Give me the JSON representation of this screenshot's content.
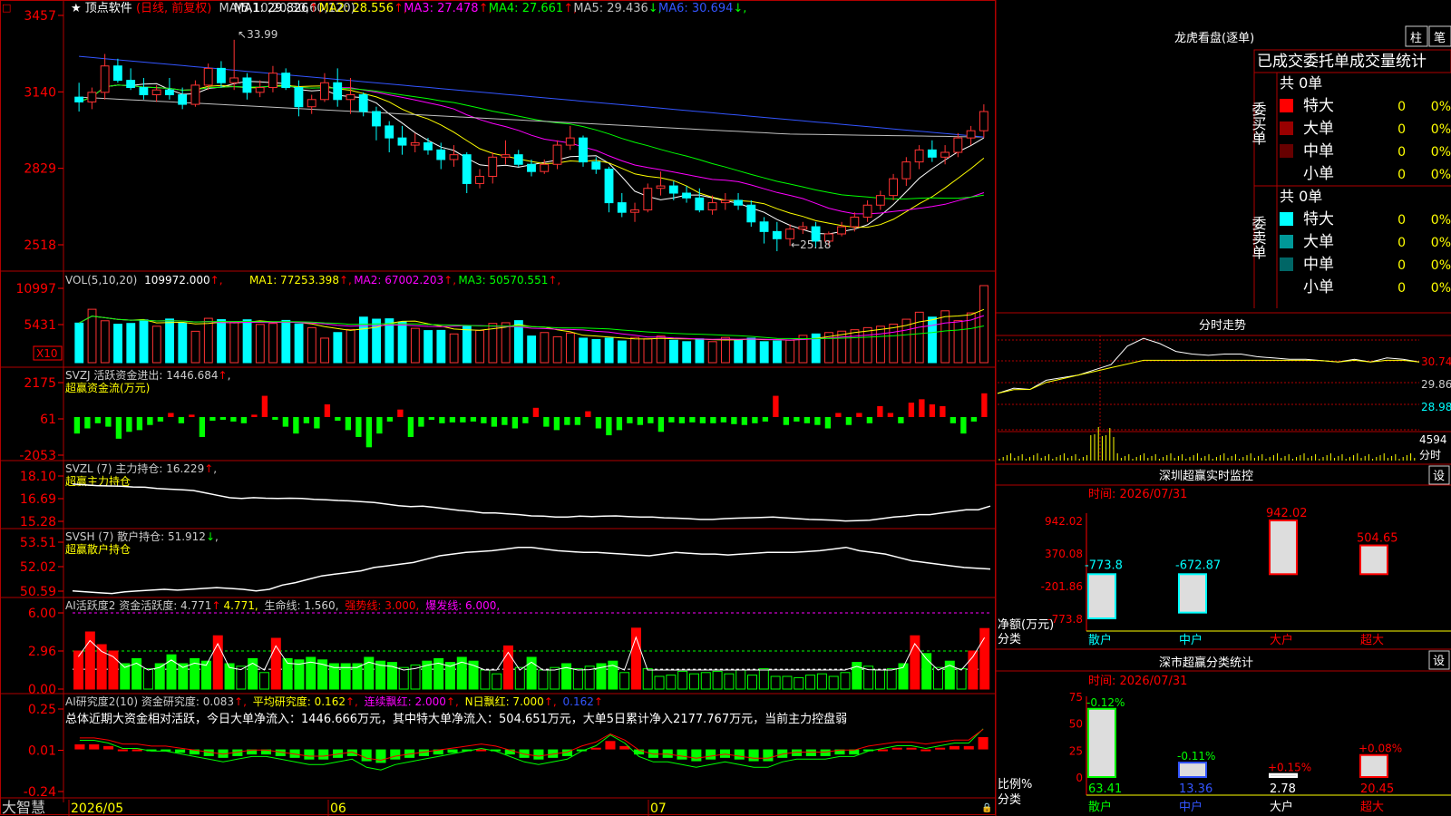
{
  "stock": {
    "name": "顶点软件",
    "mode": "(日线, 前复权)"
  },
  "main_panel": {
    "ma_label": "MA(5,10,20,30,60,120)",
    "ma_values": [
      {
        "label": "MA1: 29.826",
        "arrow": "↑",
        "color": "#ffffff"
      },
      {
        "label": "MA2: 28.556",
        "arrow": "↑",
        "color": "#ffff00"
      },
      {
        "label": "MA3: 27.478",
        "arrow": "↑",
        "color": "#ff00ff"
      },
      {
        "label": "MA4: 27.661",
        "arrow": "↑",
        "color": "#00ff00"
      },
      {
        "label": "MA5: 29.436",
        "arrow": "↓",
        "color": "#c0c0c0"
      },
      {
        "label": "MA6: 30.694",
        "arrow": "↓",
        "color": "#3355ff"
      }
    ],
    "y_ticks": [
      "3457",
      "3140",
      "2829",
      "2518"
    ],
    "high_label": "33.99",
    "low_label": "25.18"
  },
  "vol_panel": {
    "header": "VOL(5,10,20)",
    "value": "109972.000",
    "ma": [
      {
        "label": "MA1: 77253.398",
        "arrow": "↑",
        "color": "#ffff00"
      },
      {
        "label": "MA2: 67002.203",
        "arrow": "↑",
        "color": "#ff00ff"
      },
      {
        "label": "MA3: 50570.551",
        "arrow": "↑",
        "color": "#00ff00"
      }
    ],
    "y_ticks": [
      "10997",
      "5431"
    ],
    "unit": "X10"
  },
  "svzj_panel": {
    "header": "SVZJ  活跃资金进出: 1446.684",
    "arrow": "↑",
    "sub": "超赢资金流(万元)",
    "y_ticks": [
      "2175",
      "61",
      "-2053"
    ]
  },
  "svzl_panel": {
    "header": "SVZL (7) 主力持仓: 16.229",
    "arrow": "↑",
    "sub": "超赢主力持仓",
    "y_ticks": [
      "18.10",
      "16.69",
      "15.28"
    ]
  },
  "svsh_panel": {
    "header": "SVSH (7) 散户持仓: 51.912",
    "arrow": "↓",
    "sub": "超赢散户持仓",
    "y_ticks": [
      "53.51",
      "52.02",
      "50.59"
    ]
  },
  "ai_active_panel": {
    "header": "AI活跃度2 资金活跃度: 4.771",
    "val2": "4.771,",
    "life": "生命线: 1.560,",
    "strong": "强势线: 3.000,",
    "burst": "爆发线: 6.000,",
    "y_ticks": [
      "6.00",
      "2.96",
      "0.00"
    ]
  },
  "ai_research_panel": {
    "header": "AI研究度2(10) 资金研究度: 0.083",
    "avg": "平均研究度: 0.162",
    "red": "连续飘红: 2.000",
    "nred": "N日飘红: 7.000",
    "last": "0.162",
    "summary": "总体近期大资金相对活跃，今日大单净流入：1446.666万元，其中特大单净流入：504.651万元，大单5日累计净入2177.767万元，当前主力控盘弱",
    "y_ticks": [
      "0.25",
      "0.01",
      "-0.24"
    ]
  },
  "date_axis": {
    "brand": "大智慧",
    "labels": [
      "2026/05",
      "06",
      "07"
    ]
  },
  "longhu": {
    "title": "龙虎看盘(逐单)",
    "tab1": "柱",
    "tab2": "笔",
    "subtitle": "已成交委托单成交量统计",
    "buy_group": "委买单",
    "buy_total": "共 0单",
    "sell_group": "委卖单",
    "sell_total": "共 0单",
    "buy_rows": [
      {
        "label": "特大",
        "count": "0",
        "pct": "0%",
        "color": "#ff0000"
      },
      {
        "label": "大单",
        "count": "0",
        "pct": "0%",
        "color": "#990000"
      },
      {
        "label": "中单",
        "count": "0",
        "pct": "0%",
        "color": "#660000"
      },
      {
        "label": "小单",
        "count": "0",
        "pct": "0%",
        "color": ""
      }
    ],
    "sell_rows": [
      {
        "label": "特大",
        "count": "0",
        "pct": "0%",
        "color": "#00ffff"
      },
      {
        "label": "大单",
        "count": "0",
        "pct": "0%",
        "color": "#009999"
      },
      {
        "label": "中单",
        "count": "0",
        "pct": "0%",
        "color": "#006666"
      },
      {
        "label": "小单",
        "count": "0",
        "pct": "0%",
        "color": ""
      }
    ]
  },
  "intraday": {
    "title": "分时走势",
    "y_ticks": [
      "30.74",
      "29.86",
      "28.98"
    ],
    "vol_top": "4594",
    "vol_label": "分时"
  },
  "sz_monitor": {
    "title": "深圳超赢实时监控",
    "btn": "设",
    "time": "时间: 2026/07/31",
    "y_ticks": [
      "942.02",
      "370.08",
      "-201.86",
      "-773.8"
    ],
    "axis_label1": "净额(万元)",
    "axis_label2": "分类"
  },
  "sz_class": {
    "title": "深市超赢分类统计",
    "btn": "设",
    "time": "时间: 2026/07/31",
    "y_ticks": [
      "75",
      "50",
      "25",
      "0"
    ],
    "axis_label1": "比例%",
    "axis_label2": "分类"
  },
  "chart_data": [
    {
      "type": "candlestick",
      "title": "顶点软件 (日线, 前复权)",
      "x": [
        "2026/05",
        "06",
        "07"
      ],
      "ylim": [
        25.18,
        33.99
      ],
      "annotations": [
        {
          "text": "33.99",
          "kind": "high"
        },
        {
          "text": "25.18",
          "kind": "low"
        }
      ],
      "ohlc": [
        [
          31.6,
          32.2,
          31.0,
          31.4
        ],
        [
          31.4,
          32.0,
          31.1,
          31.8
        ],
        [
          31.8,
          33.4,
          31.5,
          32.9
        ],
        [
          32.9,
          33.2,
          32.2,
          32.3
        ],
        [
          32.3,
          32.8,
          31.9,
          32.0
        ],
        [
          32.0,
          32.4,
          31.5,
          31.7
        ],
        [
          31.7,
          32.1,
          31.4,
          31.9
        ],
        [
          31.9,
          32.4,
          31.5,
          31.7
        ],
        [
          31.7,
          32.0,
          31.1,
          31.3
        ],
        [
          31.3,
          32.3,
          31.2,
          32.1
        ],
        [
          32.1,
          33.0,
          31.9,
          32.8
        ],
        [
          32.8,
          33.1,
          32.0,
          32.2
        ],
        [
          32.2,
          33.99,
          31.9,
          32.4
        ],
        [
          32.4,
          32.6,
          31.5,
          31.8
        ],
        [
          31.8,
          32.3,
          31.6,
          32.0
        ],
        [
          32.0,
          32.9,
          31.8,
          32.6
        ],
        [
          32.6,
          32.8,
          31.9,
          32.0
        ],
        [
          32.0,
          32.3,
          30.8,
          31.2
        ],
        [
          31.2,
          31.7,
          30.9,
          31.5
        ],
        [
          31.5,
          32.6,
          31.4,
          32.2
        ],
        [
          32.2,
          32.8,
          31.2,
          31.5
        ],
        [
          31.5,
          32.4,
          30.9,
          31.7
        ],
        [
          31.7,
          31.8,
          30.8,
          31.0
        ],
        [
          31.0,
          31.2,
          29.8,
          30.4
        ],
        [
          30.4,
          30.6,
          29.3,
          29.9
        ],
        [
          29.9,
          30.4,
          29.2,
          29.6
        ],
        [
          29.6,
          30.1,
          29.3,
          29.7
        ],
        [
          29.7,
          29.9,
          29.2,
          29.4
        ],
        [
          29.4,
          29.7,
          28.6,
          29.0
        ],
        [
          29.0,
          29.6,
          28.7,
          29.2
        ],
        [
          29.2,
          29.3,
          27.6,
          28.0
        ],
        [
          28.0,
          28.6,
          27.8,
          28.3
        ],
        [
          28.3,
          29.3,
          28.0,
          29.1
        ],
        [
          29.1,
          29.8,
          28.8,
          29.2
        ],
        [
          29.2,
          29.4,
          28.7,
          28.8
        ],
        [
          28.8,
          29.0,
          28.3,
          28.5
        ],
        [
          28.5,
          29.0,
          28.4,
          28.8
        ],
        [
          28.8,
          29.8,
          28.6,
          29.6
        ],
        [
          29.6,
          30.4,
          29.4,
          29.9
        ],
        [
          29.9,
          30.0,
          28.7,
          28.9
        ],
        [
          28.9,
          29.1,
          28.4,
          28.6
        ],
        [
          28.6,
          28.7,
          26.8,
          27.2
        ],
        [
          27.2,
          27.6,
          26.6,
          26.8
        ],
        [
          26.8,
          27.2,
          26.4,
          26.9
        ],
        [
          26.9,
          28.0,
          26.8,
          27.8
        ],
        [
          27.8,
          28.5,
          27.5,
          27.9
        ],
        [
          27.9,
          28.1,
          27.3,
          27.6
        ],
        [
          27.6,
          27.9,
          27.2,
          27.4
        ],
        [
          27.4,
          27.8,
          26.8,
          26.9
        ],
        [
          26.9,
          27.5,
          26.7,
          27.2
        ],
        [
          27.2,
          27.6,
          26.9,
          27.3
        ],
        [
          27.3,
          27.6,
          26.9,
          27.1
        ],
        [
          27.1,
          27.3,
          26.2,
          26.4
        ],
        [
          26.4,
          26.6,
          25.5,
          26.0
        ],
        [
          26.0,
          26.4,
          25.18,
          25.7
        ],
        [
          25.7,
          26.3,
          25.4,
          26.1
        ],
        [
          26.1,
          26.4,
          25.9,
          26.2
        ],
        [
          26.2,
          26.4,
          25.3,
          25.6
        ],
        [
          25.6,
          26.0,
          25.4,
          25.9
        ],
        [
          25.9,
          26.4,
          25.8,
          26.2
        ],
        [
          26.2,
          26.8,
          26.0,
          26.6
        ],
        [
          26.6,
          27.3,
          26.4,
          27.1
        ],
        [
          27.1,
          27.7,
          26.9,
          27.5
        ],
        [
          27.5,
          28.4,
          27.3,
          28.2
        ],
        [
          28.2,
          29.1,
          27.9,
          28.9
        ],
        [
          28.9,
          29.6,
          28.6,
          29.4
        ],
        [
          29.4,
          29.8,
          28.9,
          29.1
        ],
        [
          29.1,
          29.6,
          28.8,
          29.3
        ],
        [
          29.3,
          30.1,
          29.1,
          29.9
        ],
        [
          29.9,
          30.4,
          29.6,
          30.2
        ],
        [
          30.2,
          31.3,
          29.9,
          31.0
        ]
      ]
    },
    {
      "type": "bar",
      "title": "VOL(5,10,20)",
      "ylim": [
        0,
        10997
      ],
      "values": [
        5650,
        7620,
        5980,
        5490,
        5600,
        6110,
        5200,
        6230,
        5680,
        4480,
        6330,
        6140,
        5800,
        6120,
        5460,
        5600,
        6030,
        5520,
        5000,
        3500,
        4300,
        4740,
        6500,
        6210,
        6260,
        5800,
        4900,
        4580,
        4610,
        4100,
        5300,
        4600,
        5600,
        5700,
        6000,
        3800,
        4300,
        3700,
        4230,
        3500,
        3300,
        3500,
        3100,
        3600,
        3400,
        3800,
        3200,
        3000,
        3400,
        3000,
        3600,
        3300,
        3500,
        3000,
        3100,
        3200,
        3900,
        4100,
        4300,
        4500,
        4700,
        5000,
        5200,
        5500,
        6200,
        7200,
        6500,
        7400,
        6000,
        7100,
        10997
      ],
      "colors_note": "cyan=down day, red outline=up day"
    },
    {
      "type": "bar",
      "title": "SVZJ 活跃资金进出",
      "ylim": [
        -2053,
        2175
      ],
      "values": [
        -900,
        -600,
        -300,
        -500,
        -1200,
        -800,
        -700,
        -400,
        -200,
        300,
        -300,
        200,
        -1100,
        -150,
        -100,
        -200,
        -300,
        200,
        1300,
        -100,
        -500,
        -900,
        -300,
        -600,
        800,
        -150,
        -700,
        -1100,
        -1700,
        -900,
        -200,
        500,
        -1100,
        -500,
        -100,
        -300,
        -250,
        -250,
        -200,
        -300,
        -500,
        -400,
        -600,
        -300,
        600,
        -500,
        -700,
        -400,
        -400,
        400,
        -600,
        -1000,
        -700,
        -300,
        -400,
        -300,
        -800,
        -250,
        -300,
        -250,
        -300,
        -300,
        -250,
        -350,
        -400,
        -300,
        -200,
        1300,
        -400,
        -200,
        -300,
        -400,
        -600,
        300,
        -400,
        300,
        -300,
        700,
        300,
        -300,
        900,
        1100,
        800,
        700,
        -300,
        -900,
        -200,
        1446
      ],
      "colors_note": "red positive, green negative"
    },
    {
      "type": "line",
      "title": "SVZL (7) 主力持仓",
      "ylim": [
        15.28,
        18.1
      ],
      "values": [
        17.6,
        17.55,
        17.5,
        17.48,
        17.46,
        17.42,
        17.4,
        17.32,
        17.28,
        17.25,
        17.2,
        17.05,
        16.9,
        16.75,
        16.7,
        16.75,
        16.72,
        16.7,
        16.72,
        16.7,
        16.65,
        16.62,
        16.58,
        16.55,
        16.5,
        16.45,
        16.35,
        16.25,
        16.2,
        16.22,
        16.15,
        16.05,
        15.96,
        15.9,
        15.8,
        15.8,
        15.75,
        15.7,
        15.62,
        15.6,
        15.55,
        15.55,
        15.6,
        15.58,
        15.6,
        15.62,
        15.58,
        15.55,
        15.55,
        15.5,
        15.48,
        15.45,
        15.4,
        15.4,
        15.45,
        15.48,
        15.5,
        15.52,
        15.55,
        15.5,
        15.45,
        15.4,
        15.38,
        15.35,
        15.3,
        15.32,
        15.35,
        15.45,
        15.55,
        15.6,
        15.7,
        15.7,
        15.8,
        15.9,
        16.0,
        16.0,
        16.229
      ]
    },
    {
      "type": "line",
      "title": "SVSH (7) 散户持仓",
      "ylim": [
        50.59,
        53.51
      ],
      "values": [
        50.6,
        50.55,
        50.5,
        50.45,
        50.55,
        50.6,
        50.65,
        50.7,
        50.65,
        50.7,
        50.75,
        50.8,
        50.75,
        50.7,
        50.6,
        50.7,
        50.95,
        51.1,
        51.3,
        51.5,
        51.6,
        51.7,
        51.8,
        52.0,
        52.1,
        52.2,
        52.3,
        52.5,
        52.7,
        52.8,
        52.9,
        52.95,
        53.0,
        53.1,
        53.2,
        53.2,
        53.1,
        53.0,
        52.95,
        52.9,
        52.9,
        52.85,
        52.8,
        52.75,
        52.7,
        52.8,
        52.9,
        52.85,
        52.8,
        52.8,
        52.75,
        52.8,
        52.85,
        52.9,
        52.9,
        52.9,
        52.95,
        53.0,
        53.1,
        53.2,
        53.0,
        52.9,
        52.8,
        52.6,
        52.4,
        52.3,
        52.2,
        52.1,
        52.0,
        51.95,
        51.912
      ]
    },
    {
      "type": "bar",
      "title": "AI活跃度2 资金活跃度",
      "ylim": [
        0,
        6
      ],
      "values": [
        3.0,
        4.5,
        3.5,
        3.0,
        2.0,
        2.4,
        1.6,
        2.0,
        2.7,
        2.0,
        2.4,
        2.2,
        4.2,
        2.0,
        1.8,
        2.4,
        1.3,
        4.0,
        2.4,
        2.3,
        2.5,
        2.3,
        2.0,
        2.0,
        2.0,
        2.5,
        2.2,
        2.1,
        1.7,
        1.9,
        2.2,
        2.4,
        2.1,
        2.5,
        2.2,
        1.5,
        1.2,
        3.4,
        1.7,
        2.5,
        1.5,
        1.7,
        2.0,
        1.6,
        1.8,
        2.0,
        2.2,
        1.3,
        4.8,
        1.6,
        1.0,
        1.1,
        1.4,
        1.2,
        1.3,
        1.4,
        1.2,
        1.5,
        1.1,
        1.6,
        1.0,
        1.0,
        0.9,
        1.1,
        1.2,
        1.0,
        1.3,
        2.1,
        1.8,
        1.5,
        1.6,
        2.0,
        4.2,
        2.8,
        1.7,
        2.2,
        1.6,
        3.0,
        4.771
      ],
      "reference_lines": [
        {
          "name": "生命线",
          "value": 1.56
        },
        {
          "name": "强势线",
          "value": 3.0
        },
        {
          "name": "爆发线",
          "value": 6.0
        }
      ]
    },
    {
      "type": "bar",
      "title": "AI研究度2(10) 资金研究度",
      "ylim": [
        -0.24,
        0.25
      ],
      "values": [
        0.04,
        0.04,
        0.03,
        0.01,
        0.01,
        0.0,
        0.0,
        -0.01,
        -0.02,
        -0.03,
        -0.04,
        -0.03,
        -0.02,
        -0.02,
        -0.03,
        -0.04,
        -0.05,
        -0.05,
        -0.04,
        -0.03,
        -0.06,
        -0.07,
        -0.05,
        -0.04,
        -0.03,
        -0.02,
        -0.01,
        0.0,
        0.01,
        0.0,
        -0.02,
        -0.04,
        -0.05,
        -0.04,
        -0.03,
        0.0,
        0.02,
        0.06,
        0.03,
        -0.02,
        -0.04,
        -0.04,
        -0.05,
        -0.06,
        -0.05,
        -0.04,
        -0.05,
        -0.06,
        -0.06,
        -0.04,
        -0.03,
        -0.03,
        -0.03,
        -0.02,
        -0.02,
        0.0,
        0.01,
        0.02,
        0.02,
        0.01,
        0.02,
        0.03,
        0.03,
        0.083
      ],
      "series_note": "red line = 平均研究度, green line = 资金研究度"
    },
    {
      "type": "line",
      "title": "分时走势",
      "ylim": [
        28.98,
        30.74
      ],
      "values": [
        29.4,
        29.6,
        29.55,
        29.9,
        30.0,
        30.1,
        30.3,
        30.5,
        31.2,
        31.5,
        31.3,
        31.0,
        30.9,
        30.85,
        30.9,
        30.9,
        30.8,
        30.75,
        30.7,
        30.7,
        30.65,
        30.6,
        30.7,
        30.6,
        30.75,
        30.7,
        30.6
      ]
    },
    {
      "type": "bar",
      "title": "深圳超赢实时监控",
      "categories": [
        "散户",
        "中户",
        "大户",
        "超大"
      ],
      "values": [
        -773.8,
        -672.87,
        942.02,
        504.65
      ],
      "ylabel": "净额(万元)",
      "ylim": [
        -773.8,
        942.02
      ]
    },
    {
      "type": "bar",
      "title": "深市超赢分类统计",
      "categories": [
        "散户",
        "中户",
        "大户",
        "超大"
      ],
      "values": [
        63.41,
        13.36,
        2.78,
        20.45
      ],
      "changes": [
        "-0.12%",
        "-0.11%",
        "+0.15%",
        "+0.08%"
      ],
      "ylabel": "比例%",
      "ylim": [
        0,
        75
      ]
    }
  ]
}
